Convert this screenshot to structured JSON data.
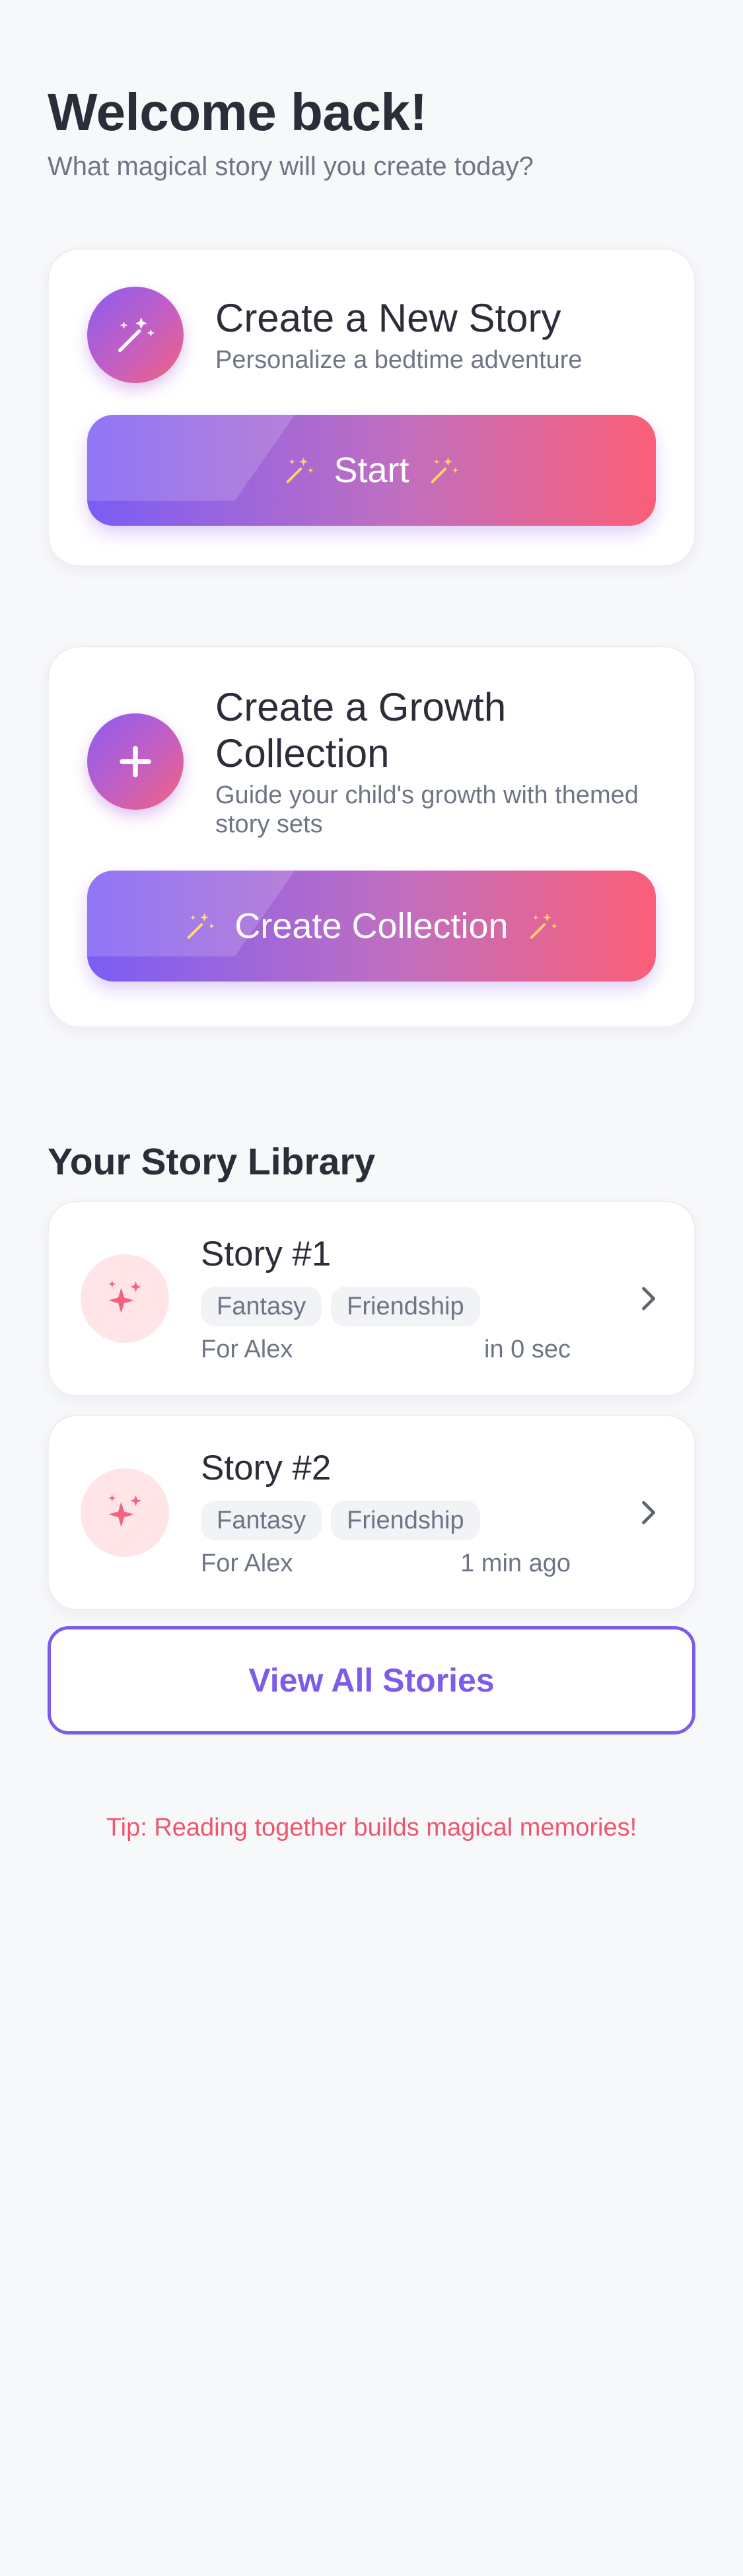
{
  "header": {
    "title": "Welcome back!",
    "subtitle": "What magical story will you create today?"
  },
  "create_story": {
    "title": "Create a New Story",
    "description": "Personalize a bedtime adventure",
    "button_label": "Start",
    "icon": "magic-wand-icon"
  },
  "growth_collection": {
    "title": "Create a Growth Collection",
    "description": "Guide your child's growth with themed story sets",
    "button_label": "Create Collection",
    "icon": "plus-icon"
  },
  "library": {
    "title": "Your Story Library",
    "stories": [
      {
        "title": "Story #1",
        "tags": [
          "Fantasy",
          "Friendship"
        ],
        "for": "For Alex",
        "time": "in 0 sec"
      },
      {
        "title": "Story #2",
        "tags": [
          "Fantasy",
          "Friendship"
        ],
        "for": "For Alex",
        "time": "1 min ago"
      }
    ],
    "view_all_label": "View All Stories"
  },
  "tip": "Tip: Reading together builds magical memories!",
  "colors": {
    "accent_purple": "#7c5ce8",
    "accent_pink": "#fb5e78",
    "tip_color": "#ee566e"
  }
}
